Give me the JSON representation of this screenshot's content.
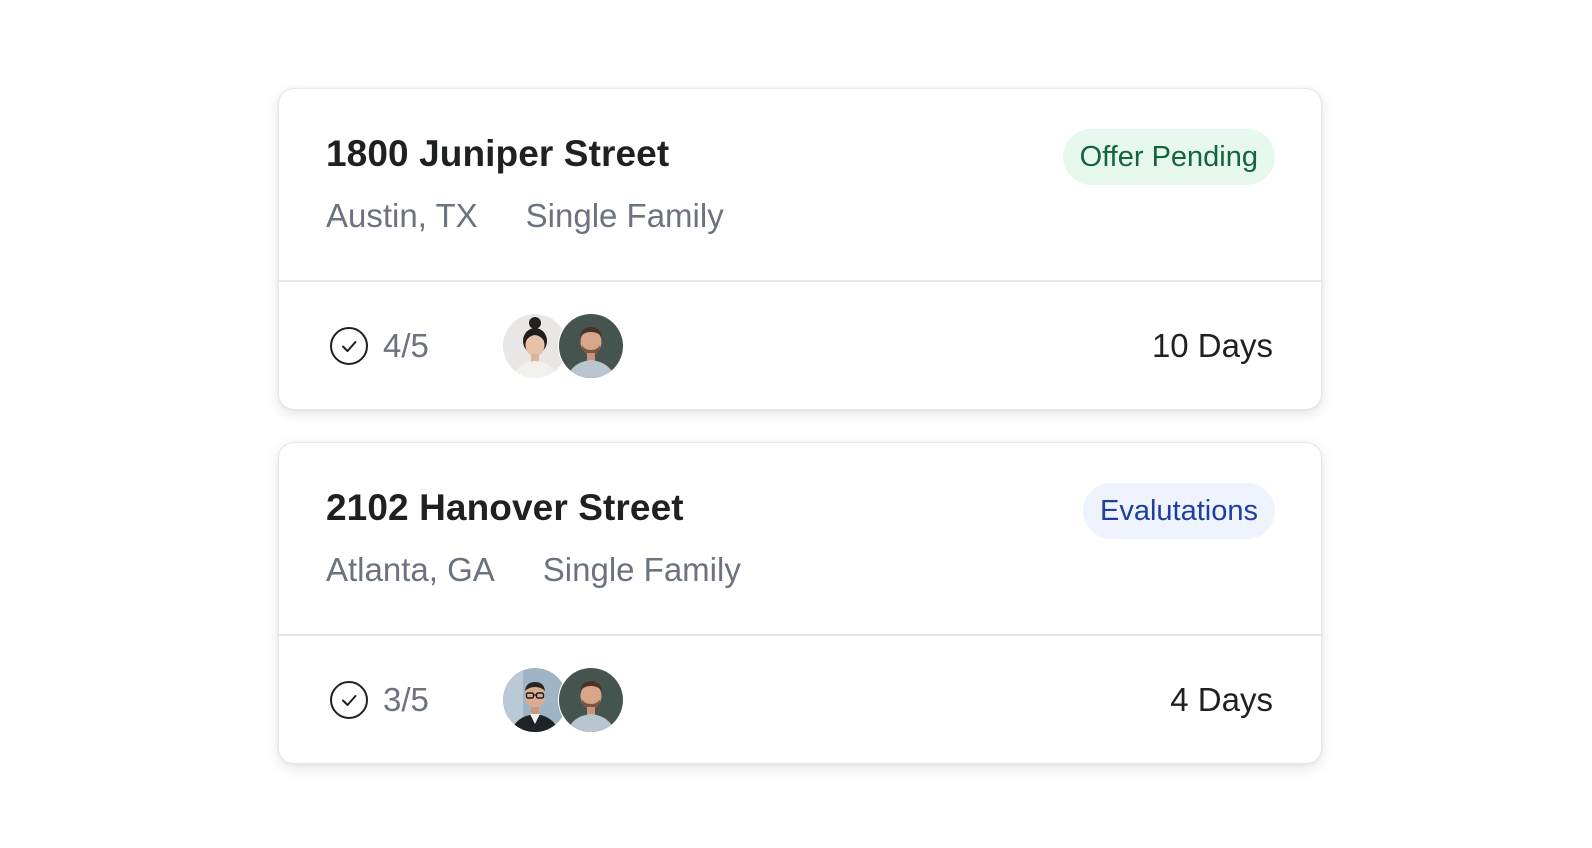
{
  "listings": [
    {
      "address": "1800 Juniper Street",
      "location": "Austin, TX",
      "property_type": "Single Family",
      "status": "Offer Pending",
      "status_color": "#14653d",
      "status_bg": "#e7f8ef",
      "tasks_completed": "4/5",
      "duration": "10 Days",
      "team": [
        "woman-with-hair-bun-avatar",
        "bearded-man-avatar"
      ]
    },
    {
      "address": "2102 Hanover Street",
      "location": "Atlanta, GA",
      "property_type": "Single Family",
      "status": "Evalutations",
      "status_color": "#1e3fa0",
      "status_bg": "#eef3fd",
      "tasks_completed": "3/5",
      "duration": "4 Days",
      "team": [
        "man-with-glasses-avatar",
        "bearded-man-avatar"
      ]
    }
  ],
  "icons": {
    "tasks": "check-circle-icon"
  }
}
